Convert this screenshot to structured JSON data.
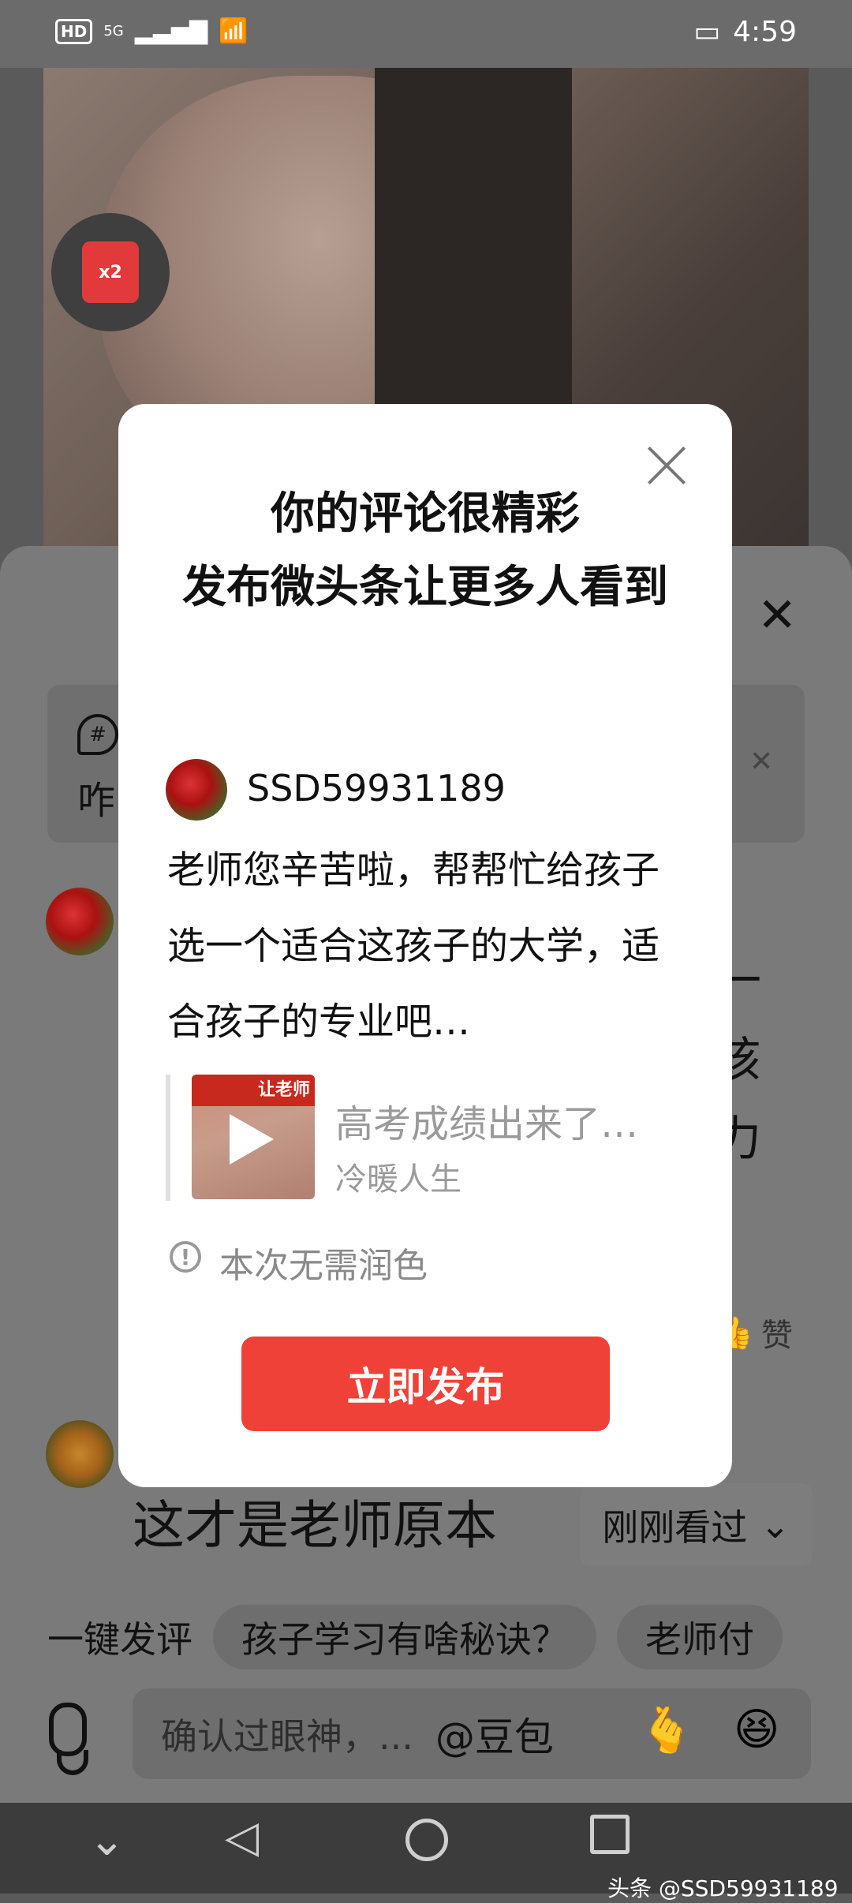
{
  "status_bar": {
    "time": "4:59",
    "network": "5G",
    "hd": "HD"
  },
  "video": {
    "badge": "x2"
  },
  "sheet": {
    "topic_fragment": "咋",
    "comment1_fragments": [
      "一",
      "该",
      "力"
    ],
    "like_label": "赞",
    "comment2_text": "这才是老师原本",
    "recent_label": "刚刚看过",
    "quick_comment_label": "一键发评",
    "quick_chips": [
      "孩子学习有啥秘诀？",
      "老师付"
    ],
    "input_placeholder": "确认过眼神，...",
    "input_at": "@豆包"
  },
  "modal": {
    "title": "你的评论很精彩\n发布微头条让更多人看到",
    "username": "SSD59931189",
    "comment": "老师您辛苦啦，帮帮忙给孩子选一个适合这孩子的大学，适合孩子的专业吧…",
    "quote_thumb_label": "让老师",
    "quote_title": "高考成绩出来了…",
    "quote_author": "冷暖人生",
    "notice": "本次无需润色",
    "publish_label": "立即发布"
  },
  "watermark": "头条 @SSD59931189"
}
